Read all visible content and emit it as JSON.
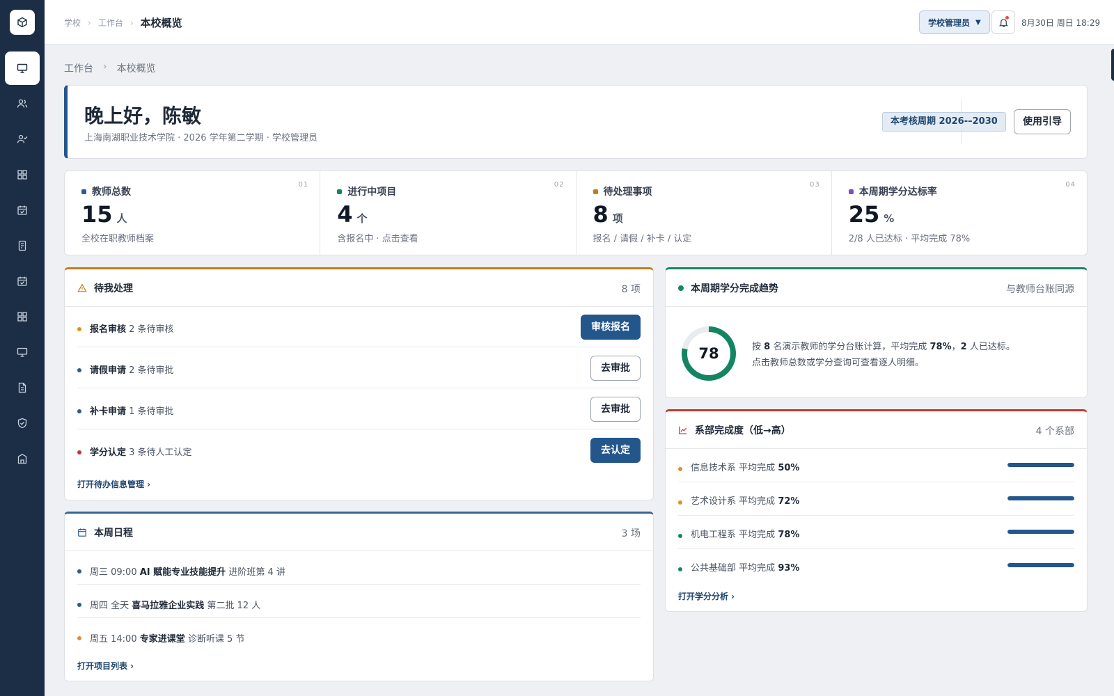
{
  "topbar": {
    "crumbs": [
      "学校",
      "工作台"
    ],
    "current": "本校概览",
    "role": "学校管理员",
    "datetime": "8月30日 周日 18:29"
  },
  "page_crumbs": [
    "工作台",
    "本校概览"
  ],
  "greeting": {
    "title": "晚上好，陈敏",
    "subtitle": "上海南湖职业技术学院 · 2026 学年第二学期 · 学校管理员",
    "period_badge": "本考核周期 2026-–2030",
    "guide_button": "使用引导"
  },
  "stats": [
    {
      "tag": "01",
      "label": "教师总数",
      "value": "15",
      "unit": "人",
      "desc": "全校在职教师档案",
      "color": "#2f5a8f"
    },
    {
      "tag": "02",
      "label": "进行中项目",
      "value": "4",
      "unit": "个",
      "desc": "含报名中 · 点击查看",
      "color": "#15875f"
    },
    {
      "tag": "03",
      "label": "待处理事项",
      "value": "8",
      "unit": "项",
      "desc": "报名 / 请假 / 补卡 / 认定",
      "color": "#c27d1a"
    },
    {
      "tag": "04",
      "label": "本周期学分达标率",
      "value": "25",
      "unit": "%",
      "desc": "2/8 人已达标 · 平均完成 78%",
      "color": "#7a4fc4"
    }
  ],
  "pending": {
    "title": "待我处理",
    "count": "8 项",
    "rows": [
      {
        "name": "报名审核",
        "detail": "2 条待审核",
        "button": "审核报名",
        "dot": "#d8922b"
      },
      {
        "name": "请假申请",
        "detail": "2 条待审批",
        "button": "去审批",
        "dot": "#2f5a8f"
      },
      {
        "name": "补卡申请",
        "detail": "1 条待审批",
        "button": "去审批",
        "dot": "#2f5a8f"
      },
      {
        "name": "学分认定",
        "detail": "3 条待人工认定",
        "button": "去认定",
        "dot": "#c0392b"
      }
    ],
    "link": "打开待办信息管理 ›"
  },
  "schedule": {
    "title": "本周日程",
    "count": "3 场",
    "rows": [
      {
        "time": "周三 09:00",
        "name": "AI 赋能专业技能提升",
        "detail": "进阶班第 4 讲",
        "dot": "#2f5a8f"
      },
      {
        "time": "周四 全天",
        "name": "喜马拉雅企业实践",
        "detail": "第二批 12 人",
        "dot": "#2f5a8f"
      },
      {
        "time": "周五 14:00",
        "name": "专家进课堂",
        "detail": "诊断听课 5 节",
        "dot": "#d8922b"
      }
    ],
    "link": "打开项目列表 ›"
  },
  "trend": {
    "title": "本周期学分完成趋势",
    "source": "与教师台账同源",
    "percent": 78,
    "percent_label": "78",
    "text_prefix": "按",
    "teacher_count": "8",
    "text_mid": "名演示教师的学分台账计算，平均完成",
    "avg": "78%",
    "text_mid2": "，",
    "passed": "2",
    "text_suffix": "人已达标。",
    "line2": "点击教师总数或学分查询可查看逐人明细。"
  },
  "departments": {
    "title": "系部完成度（低→高）",
    "count": "4 个系部",
    "rows": [
      {
        "name": "信息技术系",
        "label": "平均完成",
        "value": "50%",
        "dot": "#d8922b"
      },
      {
        "name": "艺术设计系",
        "label": "平均完成",
        "value": "72%",
        "dot": "#d8922b"
      },
      {
        "name": "机电工程系",
        "label": "平均完成",
        "value": "78%",
        "dot": "#15875f"
      },
      {
        "name": "公共基础部",
        "label": "平均完成",
        "value": "93%",
        "dot": "#15875f"
      }
    ],
    "link": "打开学分分析 ›"
  },
  "sidebar_icons": [
    "monitor-icon",
    "users-icon",
    "user-check-icon",
    "grid-icon",
    "calendar-check-icon",
    "document-icon",
    "calendar-check-icon",
    "grid-icon",
    "monitor-icon",
    "file-text-icon",
    "shield-icon",
    "building-icon"
  ]
}
